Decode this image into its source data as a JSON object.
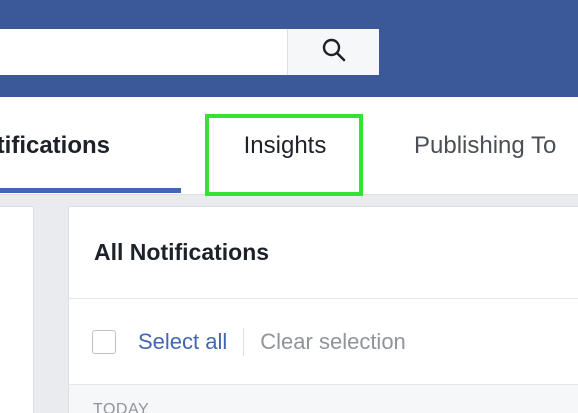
{
  "search": {
    "value": "",
    "placeholder": "",
    "icon": "search-icon"
  },
  "tabs": [
    {
      "label": "Notifications",
      "visible_text": "otifications",
      "active": true
    },
    {
      "label": "Insights",
      "highlighted": true
    },
    {
      "label": "Publishing Tools",
      "visible_text": "Publishing To"
    }
  ],
  "panel": {
    "title": "All Notifications",
    "select_all": "Select all",
    "clear_selection": "Clear selection",
    "section": "TODAY"
  },
  "colors": {
    "topbar": "#3b5998",
    "highlight": "#33e233",
    "active_tab_underline": "#4267b2",
    "link": "#4267b2"
  }
}
